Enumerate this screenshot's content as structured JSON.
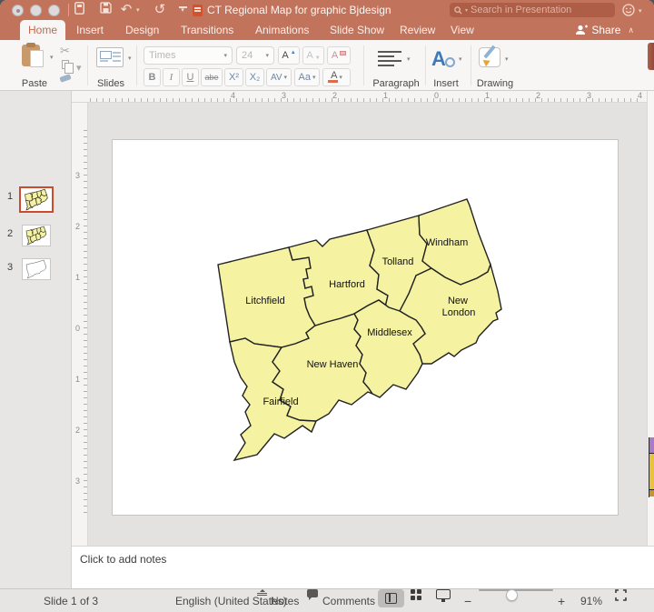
{
  "titlebar": {
    "title": "CT Regional Map for graphic Bjdesign",
    "search_placeholder": "Search in Presentation"
  },
  "tabs": [
    "Home",
    "Insert",
    "Design",
    "Transitions",
    "Animations",
    "Slide Show",
    "Review",
    "View"
  ],
  "share_label": "Share",
  "icons": {
    "caret_down": "▾",
    "chevron_up": "∧",
    "scissors": "✂",
    "undo": "↶",
    "redo": "↺",
    "more": "▾",
    "minus": "−",
    "plus": "+"
  },
  "ribbon": {
    "paste_label": "Paste",
    "slides_label": "Slides",
    "font_name": "Times",
    "font_size": "24",
    "grow_font": "A",
    "shrink_font": "A",
    "clear_format": "A",
    "bold": "B",
    "italic": "I",
    "underline": "U",
    "strikethrough": "abe",
    "superscript": "X²",
    "subscript": "X₂",
    "char_spacing": "AV",
    "change_case": "Aa",
    "font_color": "A",
    "paragraph_label": "Paragraph",
    "insert_label": "Insert",
    "drawing_label": "Drawing"
  },
  "slide_panel": {
    "slides": [
      {
        "number": "1"
      },
      {
        "number": "2"
      },
      {
        "number": "3"
      }
    ]
  },
  "rulers": {
    "horizontal": [
      "4",
      "3",
      "2",
      "1",
      "0",
      "1",
      "2",
      "3",
      "4"
    ],
    "vertical": [
      "3",
      "2",
      "1",
      "0",
      "1",
      "2",
      "3"
    ]
  },
  "map": {
    "county_fill": "#F5F2A2",
    "border_color": "#222222",
    "counties": [
      "Litchfield",
      "Hartford",
      "Tolland",
      "Windham",
      "New London",
      "Middlesex",
      "New Haven",
      "Fairfield"
    ],
    "labels": {
      "litchfield": "Litchfield",
      "hartford": "Hartford",
      "tolland": "Tolland",
      "windham": "Windham",
      "new_london_1": "New",
      "new_london_2": "London",
      "middlesex": "Middlesex",
      "new_haven": "New Haven",
      "fairfield": "Fairfield"
    }
  },
  "notes": {
    "placeholder": "Click to add notes"
  },
  "status_bar": {
    "slide_counter": "Slide 1 of 3",
    "language": "English (United States)",
    "notes_label": "Notes",
    "comments_label": "Comments",
    "zoom_level": "91%"
  }
}
